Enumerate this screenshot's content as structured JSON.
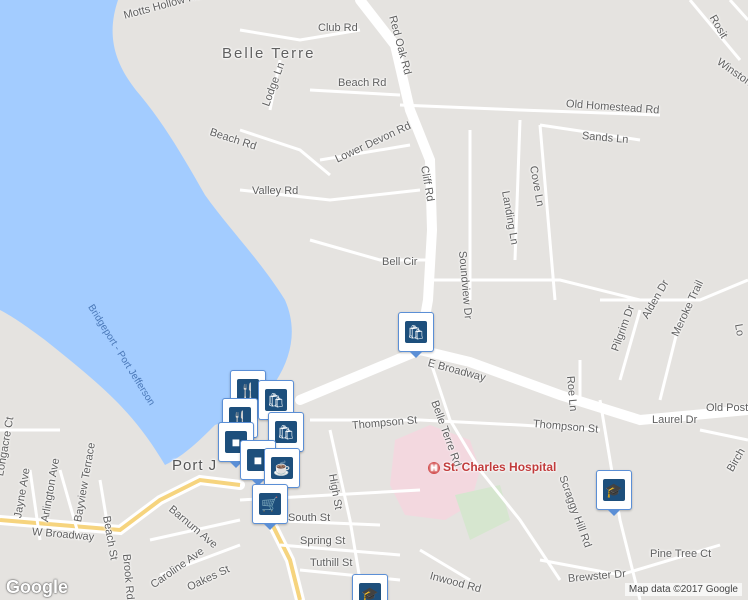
{
  "map": {
    "areas": [
      "Belle Terre",
      "Port J"
    ],
    "roads": [
      "Motts Hollow Rd",
      "Club Rd",
      "Lodge Ln",
      "Beach Rd",
      "Old Homestead Rd",
      "Sands Ln",
      "Beach Rd",
      "Lower Devon Rd",
      "Cliff Rd",
      "Cove Ln",
      "Landing Ln",
      "Valley Rd",
      "Soundview Dr",
      "Bell Cir",
      "Alden Dr",
      "Meroke Trail",
      "Pilgrim Dr",
      "E Broadway",
      "Roe Ln",
      "Belle Terre Rd",
      "Old Post",
      "Laurel Dr",
      "Thompson St",
      "Thompson St",
      "Scraggy Hill Rd",
      "High St",
      "Barnum Ave",
      "Jayne Ave",
      "Arlington Ave",
      "Bayview Terrace",
      "Beach St",
      "W Broadway",
      "Brook Rd",
      "Caroline Ave",
      "Oakes St",
      "South St",
      "Spring St",
      "Tuthill St",
      "Pine Tree Ct",
      "Brewster Dr",
      "Inwood Rd",
      "Birch",
      "Longacre Ct",
      "Winston",
      "Rosit",
      "Red Oak Rd",
      "Lo"
    ],
    "water_label": "Bridgeport - Port Jefferson",
    "poi": {
      "hospital": "St. Charles Hospital"
    },
    "markers": [
      "shopping-bag",
      "restaurant",
      "shopping-bag",
      "coffee-cup",
      "shopping-cart",
      "school",
      "school"
    ],
    "attribution": "Map data ©2017 Google",
    "logo": "Google",
    "colors": {
      "water": "#a3ccff",
      "land": "#e5e3e0",
      "road": "#ffffff",
      "hospital_area": "#f3d8df",
      "marker_border": "#5b8fd6",
      "marker_fill": "#1d4f7c"
    }
  }
}
